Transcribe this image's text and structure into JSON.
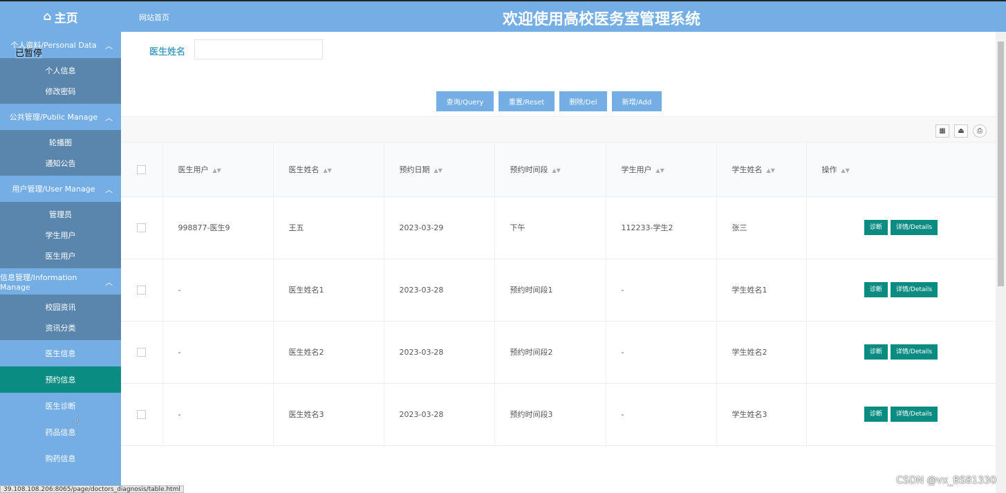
{
  "header": {
    "home_label": "主页",
    "site_home_link": "网站首页",
    "system_title": "欢迎使用高校医务室管理系统"
  },
  "overlay": {
    "paused_label": "已暂停"
  },
  "sidebar": {
    "groups": [
      {
        "title": "个人资料/Personal Data",
        "items": [
          "个人信息",
          "修改密码"
        ]
      },
      {
        "title": "公共管理/Public Manage",
        "items": [
          "轮播图",
          "通知公告"
        ]
      },
      {
        "title": "用户管理/User Manage",
        "items": [
          "管理员",
          "学生用户",
          "医生用户"
        ]
      },
      {
        "title": "信息管理/Information Manage",
        "items": [
          "校园资讯",
          "资讯分类"
        ]
      }
    ],
    "solo_items": [
      "医生信息",
      "预约信息",
      "医生诊断",
      "药品信息",
      "购药信息"
    ],
    "active_item": "预约信息"
  },
  "search": {
    "label": "医生姓名",
    "value": "",
    "placeholder": ""
  },
  "buttons": {
    "query": "查询/Query",
    "reset": "重置/Reset",
    "delete": "删除/Del",
    "add": "新增/Add"
  },
  "table": {
    "columns": [
      "医生用户",
      "医生姓名",
      "预约日期",
      "预约时间段",
      "学生用户",
      "学生姓名",
      "操作"
    ],
    "rows": [
      [
        "998877-医生9",
        "王五",
        "2023-03-29",
        "下午",
        "112233-学生2",
        "张三"
      ],
      [
        "-",
        "医生姓名1",
        "2023-03-28",
        "预约时间段1",
        "-",
        "学生姓名1"
      ],
      [
        "-",
        "医生姓名2",
        "2023-03-28",
        "预约时间段2",
        "-",
        "学生姓名2"
      ],
      [
        "-",
        "医生姓名3",
        "2023-03-28",
        "预约时间段3",
        "-",
        "学生姓名3"
      ]
    ],
    "action_diagnose": "诊断",
    "action_details": "详情/Details"
  },
  "status_bar": {
    "url": "39.108.108.206:8065/page/doctors_diagnosis/table.html"
  },
  "watermark": "CSDN @vx_BS81330",
  "colors": {
    "header": "#74aee4",
    "sidebar_sub": "#5a86ad",
    "active": "#0b8c82",
    "label": "#4fa2c4"
  }
}
